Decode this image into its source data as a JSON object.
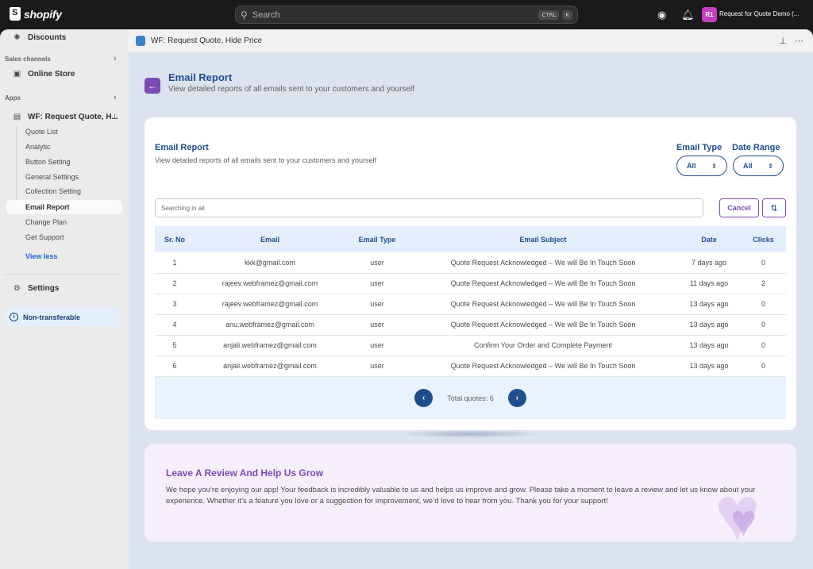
{
  "topbar": {
    "brand": "shopify",
    "search_placeholder": "Search",
    "shortcut_ctrl": "CTRL",
    "shortcut_key": "K",
    "store_initials": "R1",
    "store_name": "Request for Quote Demo (..."
  },
  "sidebar": {
    "discounts": "Discounts",
    "sales_channels": "Sales channels",
    "online_store": "Online Store",
    "apps": "Apps",
    "app_name": "WF: Request Quote, H...",
    "sub_items": [
      "Quote List",
      "Analytic",
      "Button Setting",
      "General Settings",
      "Collection Setting",
      "Email Report",
      "Change Plan",
      "Get Support"
    ],
    "active_item": "Email Report",
    "view_less": "View less",
    "settings": "Settings",
    "non_transferable": "Non-transferable"
  },
  "app_header": {
    "title": "WF: Request Quote, Hide Price"
  },
  "page": {
    "title": "Email Report",
    "subtitle": "View detailed reports of all emails sent to your customers and yourself"
  },
  "card": {
    "title": "Email Report",
    "subtitle": "View detailed reports of all emails sent to your customers and yourself",
    "email_type_label": "Email Type",
    "email_type_value": "All",
    "date_range_label": "Date Range",
    "date_range_value": "All",
    "search_placeholder": "Searching in all",
    "cancel_label": "Cancel"
  },
  "table": {
    "headers": [
      "Sr. No",
      "Email",
      "Email Type",
      "Email Subject",
      "Date",
      "Clicks"
    ],
    "rows": [
      [
        "1",
        "kkk@gmail.com",
        "user",
        "Quote Request Acknowledged – We will Be In Touch Soon",
        "7 days ago",
        "0"
      ],
      [
        "2",
        "rajeev.webframez@gmail.com",
        "user",
        "Quote Request Acknowledged – We will Be In Touch Soon",
        "11 days ago",
        "2"
      ],
      [
        "3",
        "rajeev.webframez@gmail.com",
        "user",
        "Quote Request Acknowledged – We will Be In Touch Soon",
        "13 days ago",
        "0"
      ],
      [
        "4",
        "anu.webframez@gmail.com",
        "user",
        "Quote Request Acknowledged – We will Be In Touch Soon",
        "13 days ago",
        "0"
      ],
      [
        "5",
        "anjali.webframez@gmail.com",
        "user",
        "Confirm Your Order and Complete Payment",
        "13 days ago",
        "0"
      ],
      [
        "6",
        "anjali.webframez@gmail.com",
        "user",
        "Quote Request Acknowledged – We will Be In Touch Soon",
        "13 days ago",
        "0"
      ]
    ]
  },
  "pagination": {
    "total_text": "Total quotes: 6"
  },
  "review": {
    "title": "Leave A Review And Help Us Grow",
    "text": "We hope you’re enjoying our app! Your feedback is incredibly valuable to us and helps us improve and grow. Please take a moment to leave a review and let us know about your experience. Whether it’s a feature you love or a suggestion for improvement, we’d love to hear from you. Thank you for your support!"
  },
  "colors": {
    "accent_blue": "#1f4e8c",
    "accent_purple": "#7b4bb7",
    "store_badge": "#c73ec6"
  }
}
